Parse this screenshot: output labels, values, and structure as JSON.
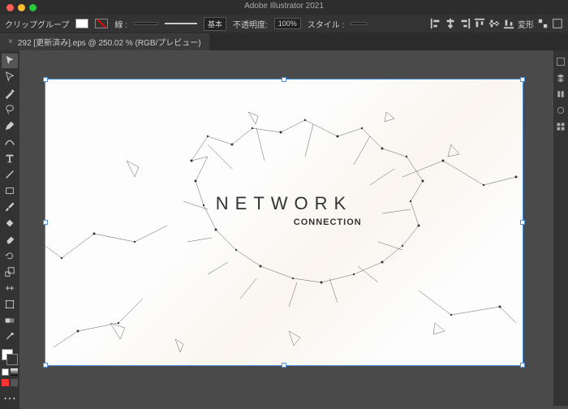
{
  "window": {
    "app_title": "Adobe Illustrator 2021"
  },
  "controlbar": {
    "group_label": "クリップグループ",
    "stroke_label": "線 :",
    "stroke_weight": "",
    "basic_label": "基本",
    "opacity_label": "不透明度:",
    "opacity_value": "100%",
    "style_label": "スタイル :",
    "transform_label": "変形"
  },
  "tab": {
    "name": "292 [更新済み].eps @ 250.02 % (RGB/プレビュー)"
  },
  "artwork": {
    "title": "NETWORK",
    "subtitle": "CONNECTION"
  }
}
